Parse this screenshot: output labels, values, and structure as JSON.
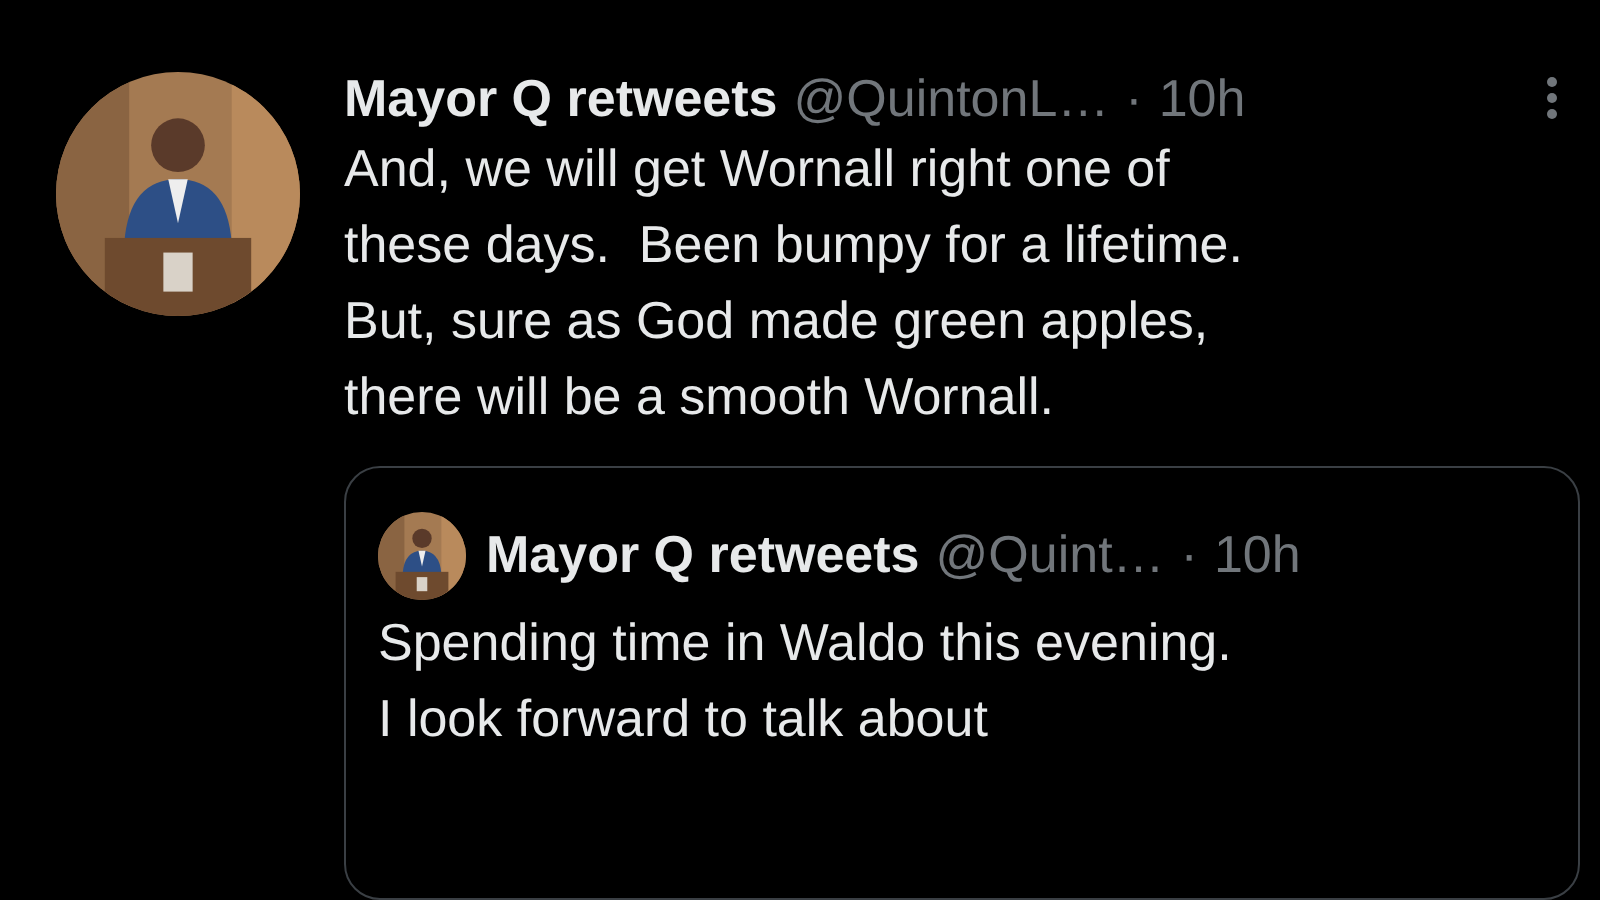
{
  "tweet": {
    "author": "Mayor Q retweets",
    "handle": "@QuintonL…",
    "separator": "·",
    "time": "10h",
    "text_lines": [
      "And, we will get Wornall right one of",
      "these days.  Been bumpy for a lifetime.",
      "But, sure as God made green apples,",
      "there will be a smooth Wornall."
    ],
    "quote": {
      "author": "Mayor Q retweets",
      "handle": "@Quint…",
      "separator": "·",
      "time": "10h",
      "text_lines": [
        "Spending time in Waldo this evening.",
        "I look forward to talk about"
      ]
    }
  }
}
